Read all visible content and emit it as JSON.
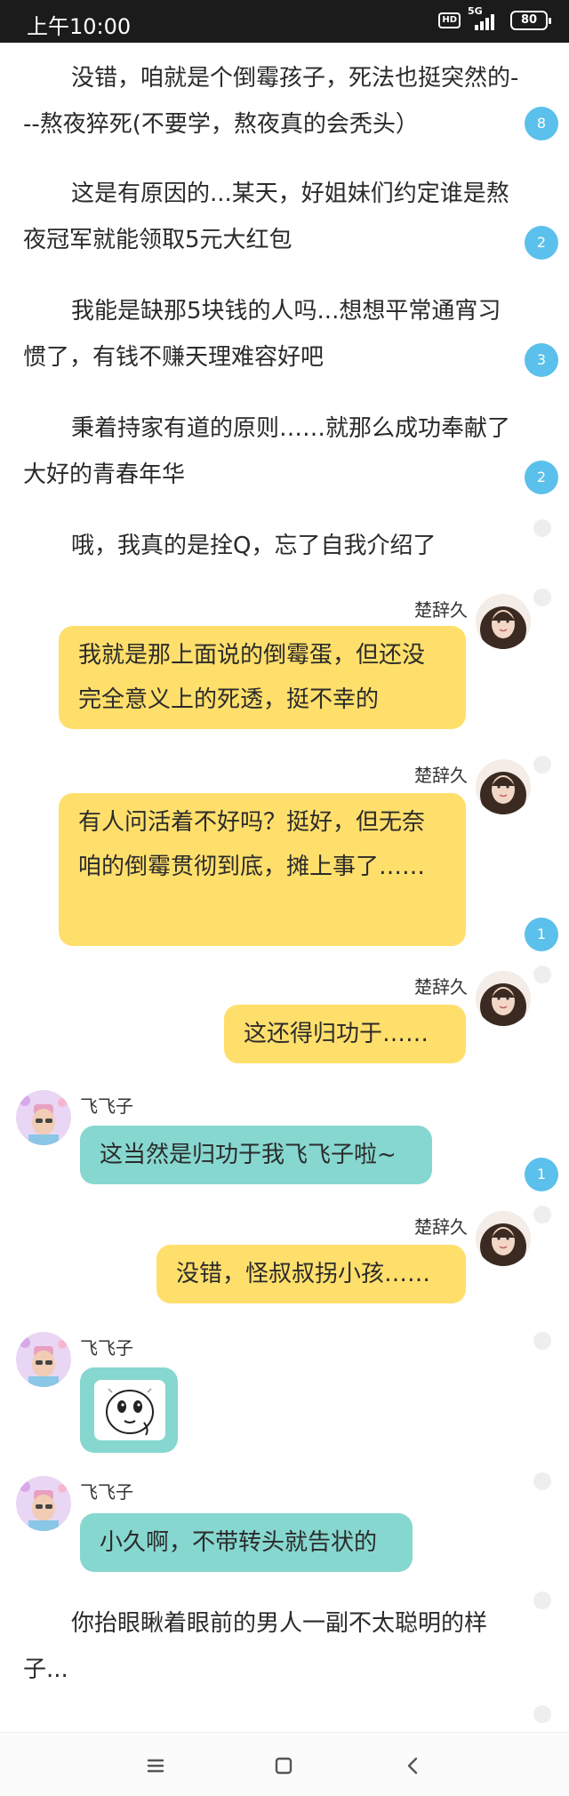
{
  "status_bar": {
    "time": "上午10:00",
    "hd_label": "HD",
    "network": "5G",
    "battery": "80"
  },
  "story": {
    "p1": "没错，咱就是个倒霉孩子，死法也挺突然的---熬夜猝死(不要学，熬夜真的会秃头）",
    "p1_comments": "8",
    "p2": "这是有原因的...某天，好姐妹们约定谁是熬夜冠军就能领取5元大红包",
    "p2_comments": "2",
    "p3": "我能是缺那5块钱的人吗...想想平常通宵习惯了，有钱不赚天理难容好吧",
    "p3_comments": "3",
    "p4": "秉着持家有道的原则……就那么成功奉献了大好的青春年华",
    "p4_comments": "2",
    "p5": "哦，我真的是拴Q，忘了自我介绍了",
    "p_last": "你抬眼瞅着眼前的男人一副不太聪明的样子..."
  },
  "chat": {
    "m1": {
      "name": "楚辞久",
      "text": "我就是那上面说的倒霉蛋，但还没完全意义上的死透，挺不幸的"
    },
    "m2": {
      "name": "楚辞久",
      "text": "有人问活着不好吗？挺好，但无奈咱的倒霉贯彻到底，摊上事了……",
      "comments": "1"
    },
    "m3": {
      "name": "楚辞久",
      "text": "这还得归功于……"
    },
    "m4": {
      "name": "飞飞子",
      "text": "这当然是归功于我飞飞子啦~",
      "comments": "1"
    },
    "m5": {
      "name": "楚辞久",
      "text": "没错，怪叔叔拐小孩……"
    },
    "m6": {
      "name": "飞飞子"
    },
    "m7": {
      "name": "飞飞子",
      "text": "小久啊，不带转头就告状的"
    }
  },
  "colors": {
    "accent_badge": "#5bc0eb",
    "bubble_yellow": "#ffdf6b",
    "bubble_teal": "#86d7cf"
  },
  "icons": {
    "menu": "menu-icon",
    "home": "home-square-icon",
    "back": "back-chevron-icon"
  }
}
